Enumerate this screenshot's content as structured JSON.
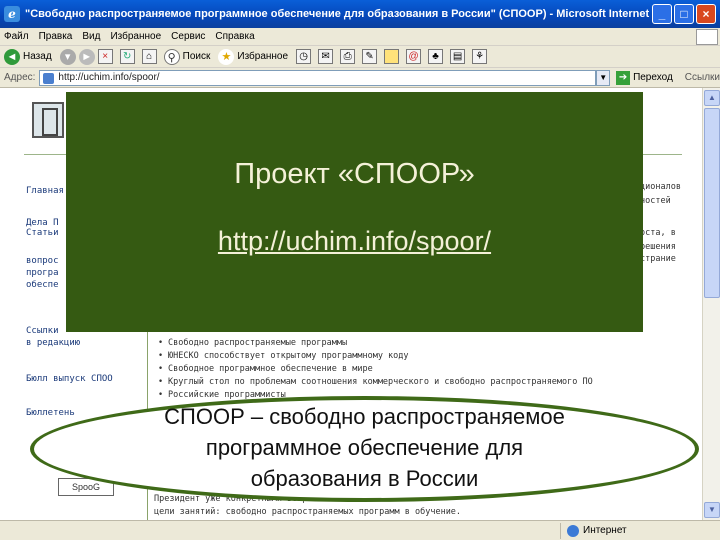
{
  "window": {
    "title": "\"Свободно распространяемое программное обеспечение для образования в России\" (СПООР) - Microsoft Internet Explorer",
    "min": "_",
    "max": "□",
    "close": "×"
  },
  "menu": [
    "Файл",
    "Правка",
    "Вид",
    "Избранное",
    "Сервис",
    "Справка"
  ],
  "toolbar": {
    "back": "Назад",
    "search": "Поиск",
    "favorites": "Избранное"
  },
  "address": {
    "label": "Адрес:",
    "url": "http://uchim.info/spoor/",
    "go": "Переход",
    "links": "Ссылки"
  },
  "page": {
    "sidebar": [
      "Главная",
      "Дела П",
      "Статьи",
      "вопрос",
      "програ",
      "обеспе",
      "Ссылки",
      "в редакцию",
      "Бюлл выпуск СПОО",
      "Бюллетень",
      "SpooG"
    ],
    "bullets": [
      "Свободно распространяемые программы",
      "ЮНЕСКО способствует открытому программному коду",
      "Свободное программное обеспечение в мире",
      "Круглый стол по проблемам соотношения коммерческого и свободно распространяемого ПО",
      "Российские программисты"
    ],
    "right_fragments": [
      "ционалов",
      "ностей",
      "оста, в",
      "решения",
      "страние"
    ],
    "bottom_lines": [
      "Президент                                                   уже конкретными вопросами",
      "цели занятий: свободно распространяемых программ в обучение."
    ]
  },
  "status": {
    "zone": "Интернет"
  },
  "slide": {
    "title": "Проект «СПООР»",
    "link": "http://uchim.info/spoor/",
    "caption_lines": [
      "СПООР – свободно распространяемое",
      "программное обеспечение для",
      "образования в России"
    ]
  },
  "colors": {
    "panel_green": "#355a12",
    "oval_border": "#3f6a18",
    "panel_text": "#f4f1d8"
  }
}
